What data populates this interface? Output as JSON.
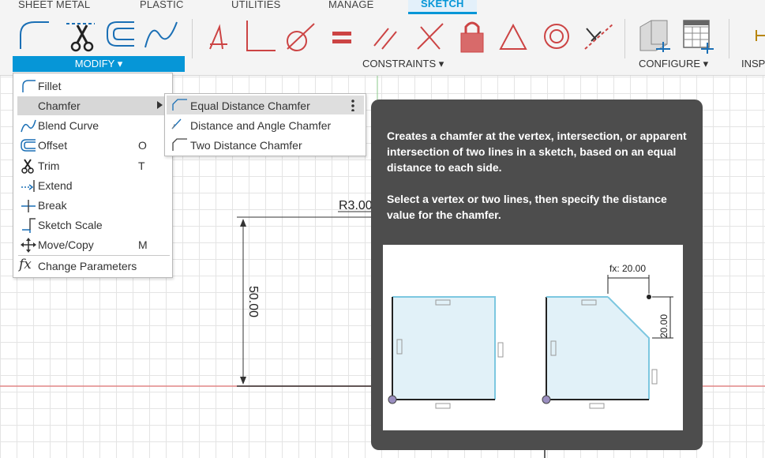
{
  "toolbar": {
    "tabs": [
      "SHEET METAL",
      "PLASTIC",
      "UTILITIES",
      "MANAGE",
      "SKETCH"
    ],
    "active_tab": "SKETCH",
    "groups": {
      "modify": "MODIFY ▾",
      "constraints": "CONSTRAINTS ▾",
      "configure": "CONFIGURE ▾",
      "inspect": "INSP"
    },
    "accent_color": "#0696d7"
  },
  "modify_menu": {
    "items": [
      {
        "label": "Fillet",
        "shortcut": "",
        "icon": "fillet-icon"
      },
      {
        "label": "Chamfer",
        "shortcut": "",
        "icon": "chamfer-icon",
        "submenu": true
      },
      {
        "label": "Blend Curve",
        "shortcut": "",
        "icon": "blend-curve-icon"
      },
      {
        "label": "Offset",
        "shortcut": "O",
        "icon": "offset-icon"
      },
      {
        "label": "Trim",
        "shortcut": "T",
        "icon": "scissors-icon"
      },
      {
        "label": "Extend",
        "shortcut": "",
        "icon": "extend-icon"
      },
      {
        "label": "Break",
        "shortcut": "",
        "icon": "break-icon"
      },
      {
        "label": "Sketch Scale",
        "shortcut": "",
        "icon": "sketch-scale-icon"
      },
      {
        "label": "Move/Copy",
        "shortcut": "M",
        "icon": "move-icon"
      },
      {
        "label": "Change Parameters",
        "shortcut": "",
        "icon": "fx-icon"
      }
    ],
    "fx_glyph": "fx"
  },
  "chamfer_submenu": {
    "items": [
      "Equal Distance Chamfer",
      "Distance and Angle Chamfer",
      "Two Distance Chamfer"
    ]
  },
  "canvas": {
    "dimension_vertical": "50.00",
    "dimension_radius": "R3.00"
  },
  "tooltip": {
    "line1": "Creates a chamfer at the vertex, intersection, or apparent intersection of two lines in a sketch, based on an equal distance to each side.",
    "line2": "Select a vertex or two lines, then specify the distance value for the chamfer.",
    "illustration": {
      "fx_label": "fx: 20.00",
      "vertical_label": "20.00"
    }
  }
}
